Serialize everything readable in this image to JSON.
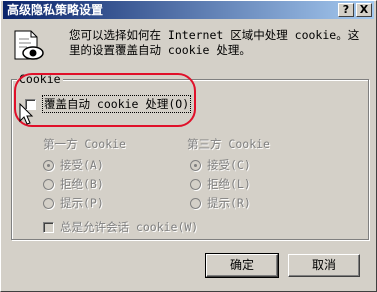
{
  "window": {
    "title": "高级隐私策略设置",
    "help_btn": "?",
    "close_btn": "X"
  },
  "intro": {
    "line1": "您可以选择如何在 Internet 区域中处理 cookie。这",
    "line2": "里的设置覆盖自动 cookie 处理。"
  },
  "cookie_group": {
    "label": "Cookie",
    "override_label": "覆盖自动 cookie 处理(O)",
    "override_checked": false,
    "first_party": {
      "heading": "第一方 Cookie",
      "options": [
        "接受(A)",
        "拒绝(B)",
        "提示(P)"
      ],
      "selected": "接受(A)"
    },
    "third_party": {
      "heading": "第三方 Cookie",
      "options": [
        "接受(C)",
        "拒绝(L)",
        "提示(R)"
      ],
      "selected": "接受(C)"
    },
    "session_label": "总是允许会话 cookie(W)",
    "session_checked": false
  },
  "buttons": {
    "ok": "确定",
    "cancel": "取消"
  },
  "colors": {
    "face": "#d4d0c8",
    "title_start": "#0a246a",
    "title_end": "#a6caf0",
    "annotation": "#e0102a"
  },
  "icons": {
    "privacy": "document-eye-icon",
    "cursor": "arrow-cursor-icon"
  }
}
